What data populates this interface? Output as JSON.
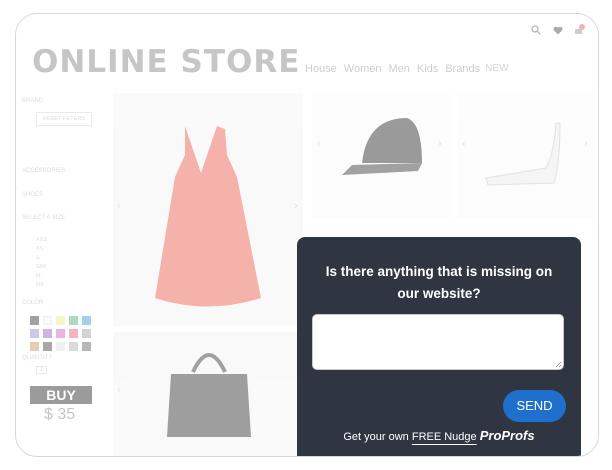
{
  "store": {
    "brand_title": "ONLINE STORE",
    "nav": [
      "House",
      "Women",
      "Men",
      "Kids",
      "Brands",
      "NEW"
    ],
    "filters": {
      "brand_label": "BRAND",
      "reset_label": "RESET FILTERS",
      "accessories_label": "ACCESSORIES",
      "shoes_label": "SHOES",
      "size_label": "SELECT A SIZE",
      "sizes": [
        "XXS",
        "XS",
        "S",
        "S/M",
        "M",
        "M/L"
      ],
      "colors_label": "COLOR",
      "quantity_label": "QUANTITY",
      "quantity_value": "1"
    },
    "buy_label": "BUY",
    "price": "$ 35",
    "swatch_colors": [
      "#222222",
      "#f5f5f5",
      "#e8e87a",
      "#3aa86b",
      "#2b8fd6",
      "#7f7fd6",
      "#8d4fb5",
      "#d14fb5",
      "#e84f6f",
      "#999999",
      "#c08a4a",
      "#333333",
      "#dddddd",
      "#aaaaaa",
      "#555555"
    ]
  },
  "popup": {
    "question": "Is there anything that is missing on our website?",
    "textarea_value": "",
    "send_label": "SEND",
    "footer_prefix": "Get your own ",
    "footer_link": "FREE Nudge",
    "footer_brand": "ProProfs"
  },
  "colors": {
    "popup_bg": "#2f3641",
    "send_bg": "#1f6fcc"
  }
}
